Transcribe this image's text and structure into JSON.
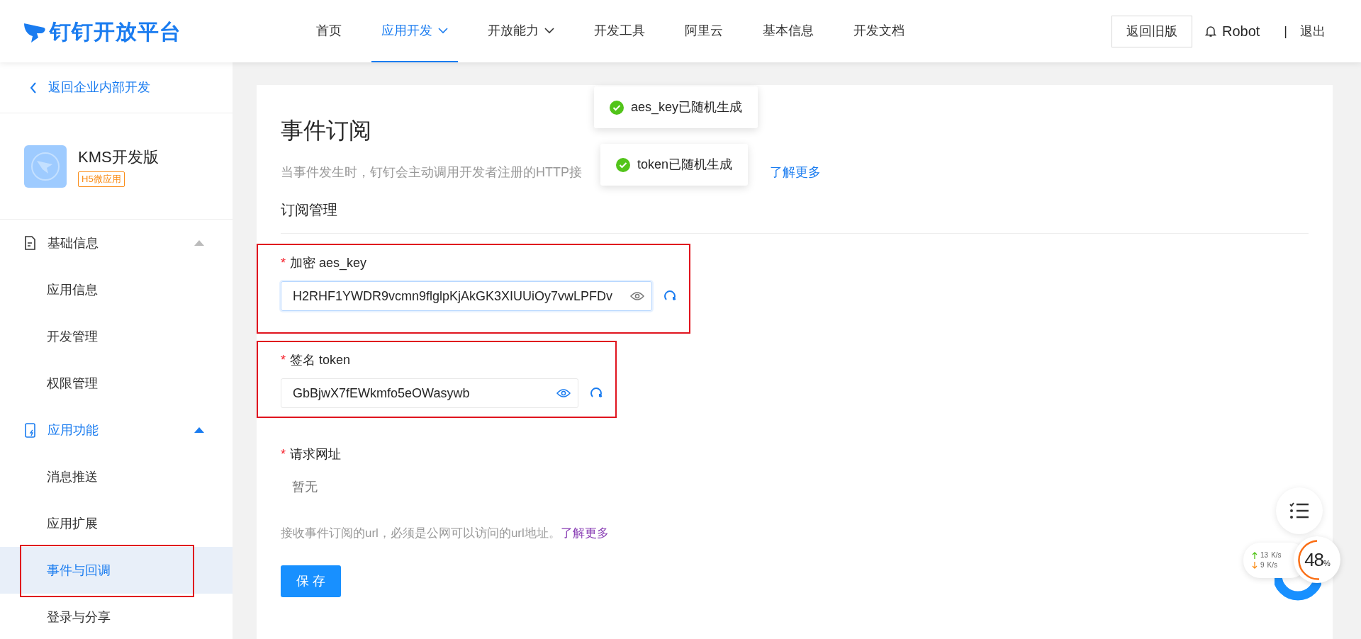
{
  "header": {
    "logo": "钉钉开放平台",
    "nav": [
      {
        "label": "首页",
        "selected": false,
        "has_menu": false
      },
      {
        "label": "应用开发",
        "selected": true,
        "has_menu": true
      },
      {
        "label": "开放能力",
        "selected": false,
        "has_menu": true
      },
      {
        "label": "开发工具",
        "selected": false,
        "has_menu": false
      },
      {
        "label": "阿里云",
        "selected": false,
        "has_menu": false
      },
      {
        "label": "基本信息",
        "selected": false,
        "has_menu": false
      },
      {
        "label": "开发文档",
        "selected": false,
        "has_menu": false
      }
    ],
    "old_version_button": "返回旧版",
    "user": "Robot",
    "separator": "|",
    "logout": "退出"
  },
  "sidebar": {
    "back_link": "返回企业内部开发",
    "app": {
      "name": "KMS开发版",
      "tag": "H5微应用"
    },
    "groups": [
      {
        "label": "基础信息",
        "expanded": true,
        "active": false,
        "items": [
          {
            "label": "应用信息",
            "selected": false,
            "highlighted": false
          },
          {
            "label": "开发管理",
            "selected": false,
            "highlighted": false
          },
          {
            "label": "权限管理",
            "selected": false,
            "highlighted": false
          }
        ]
      },
      {
        "label": "应用功能",
        "expanded": true,
        "active": true,
        "items": [
          {
            "label": "消息推送",
            "selected": false,
            "highlighted": false
          },
          {
            "label": "应用扩展",
            "selected": false,
            "highlighted": false
          },
          {
            "label": "事件与回调",
            "selected": true,
            "highlighted": true
          },
          {
            "label": "登录与分享",
            "selected": false,
            "highlighted": false
          }
        ]
      }
    ]
  },
  "main": {
    "title": "事件订阅",
    "description": "当事件发生时，钉钉会主动调用开发者注册的HTTP接",
    "description_link": "了解更多",
    "section": "订阅管理",
    "fields": [
      {
        "label": "加密 aes_key",
        "required_mark": "*",
        "value": "H2RHF1YWDR9vcmn9flglpKjAkGK3XIUUiOy7vwLPFDv",
        "focused": true,
        "highlighted": true
      },
      {
        "label": "签名 token",
        "required_mark": "*",
        "value": "GbBjwX7fEWkmfo5eOWasywb",
        "focused": false,
        "highlighted": true
      }
    ],
    "url": {
      "label": "请求网址",
      "required_mark": "*",
      "placeholder": "暂无"
    },
    "help": "接收事件订阅的url，必须是公网可以访问的url地址。",
    "help_link": "了解更多",
    "save_button": "保 存"
  },
  "toasts": [
    "aes_key已随机生成",
    "token已随机生成"
  ],
  "speed_widget": {
    "upload": "13",
    "download": "9",
    "unit_up": "K/s",
    "unit_down": "K/s",
    "percent": "48",
    "percent_sign": "%"
  }
}
